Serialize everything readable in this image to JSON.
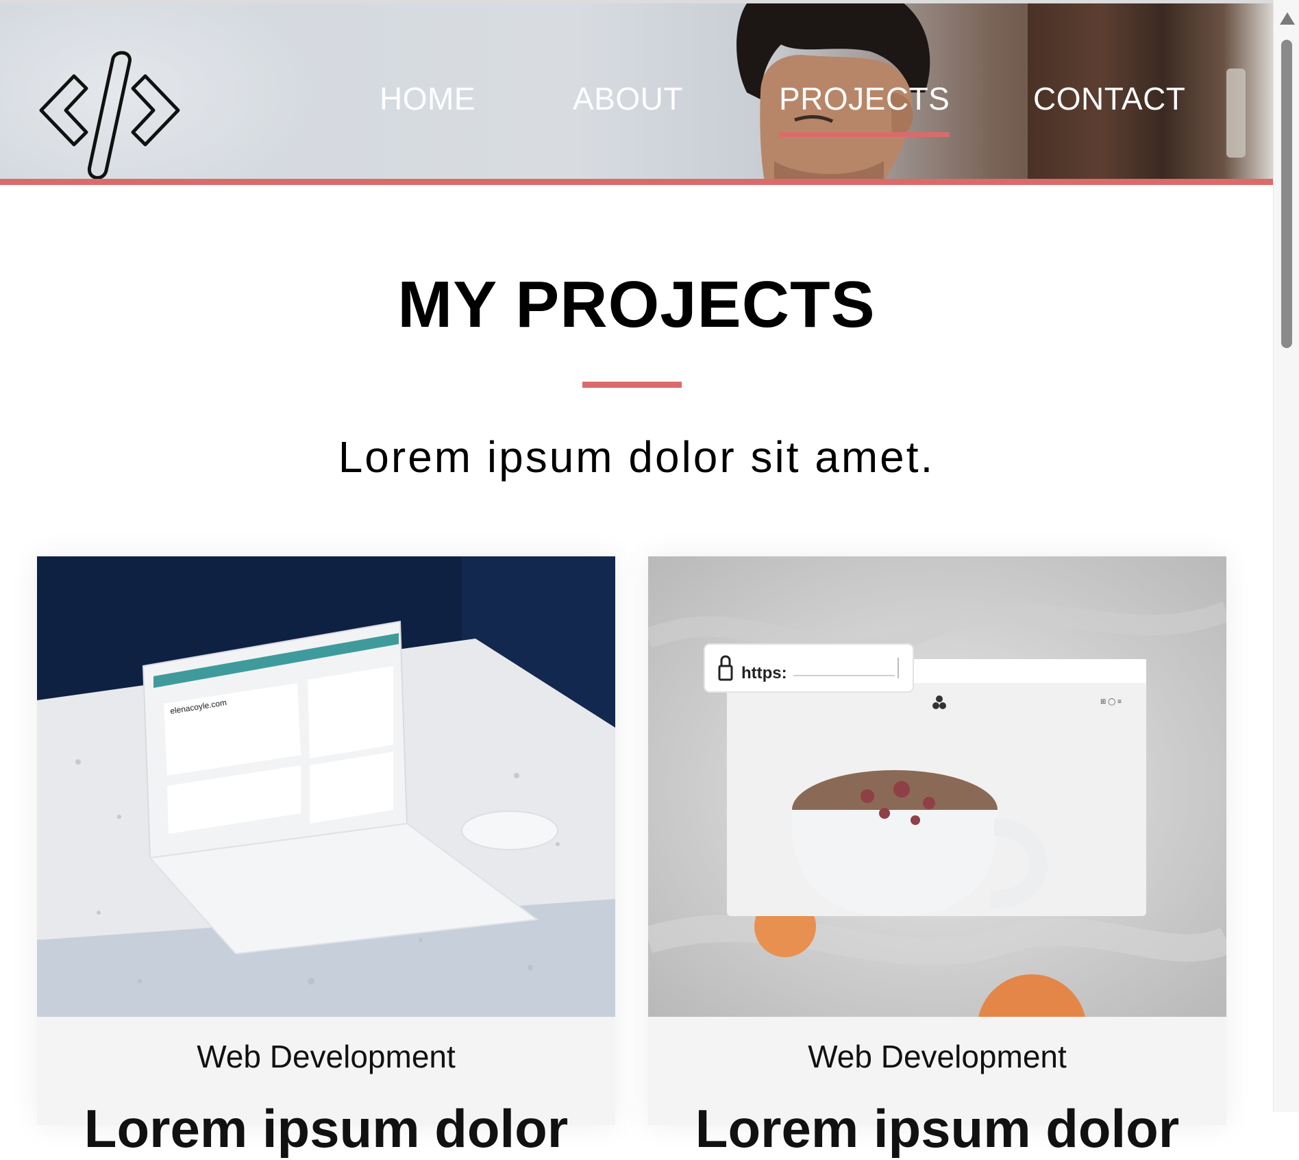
{
  "header": {
    "nav": [
      {
        "label": "HOME",
        "active": false
      },
      {
        "label": "ABOUT",
        "active": false
      },
      {
        "label": "PROJECTS",
        "active": true
      },
      {
        "label": "CONTACT",
        "active": false
      }
    ],
    "logo_icon": "code-brackets-icon",
    "accent_color": "#db6b6b"
  },
  "main": {
    "title": "MY PROJECTS",
    "subtitle": "Lorem ipsum dolor sit amet."
  },
  "projects": [
    {
      "category": "Web Development",
      "title": "Lorem ipsum dolor",
      "screen_url": "elenacoyle.com"
    },
    {
      "category": "Web Development",
      "title": "Lorem ipsum dolor",
      "url_bar_text": "https:"
    }
  ]
}
